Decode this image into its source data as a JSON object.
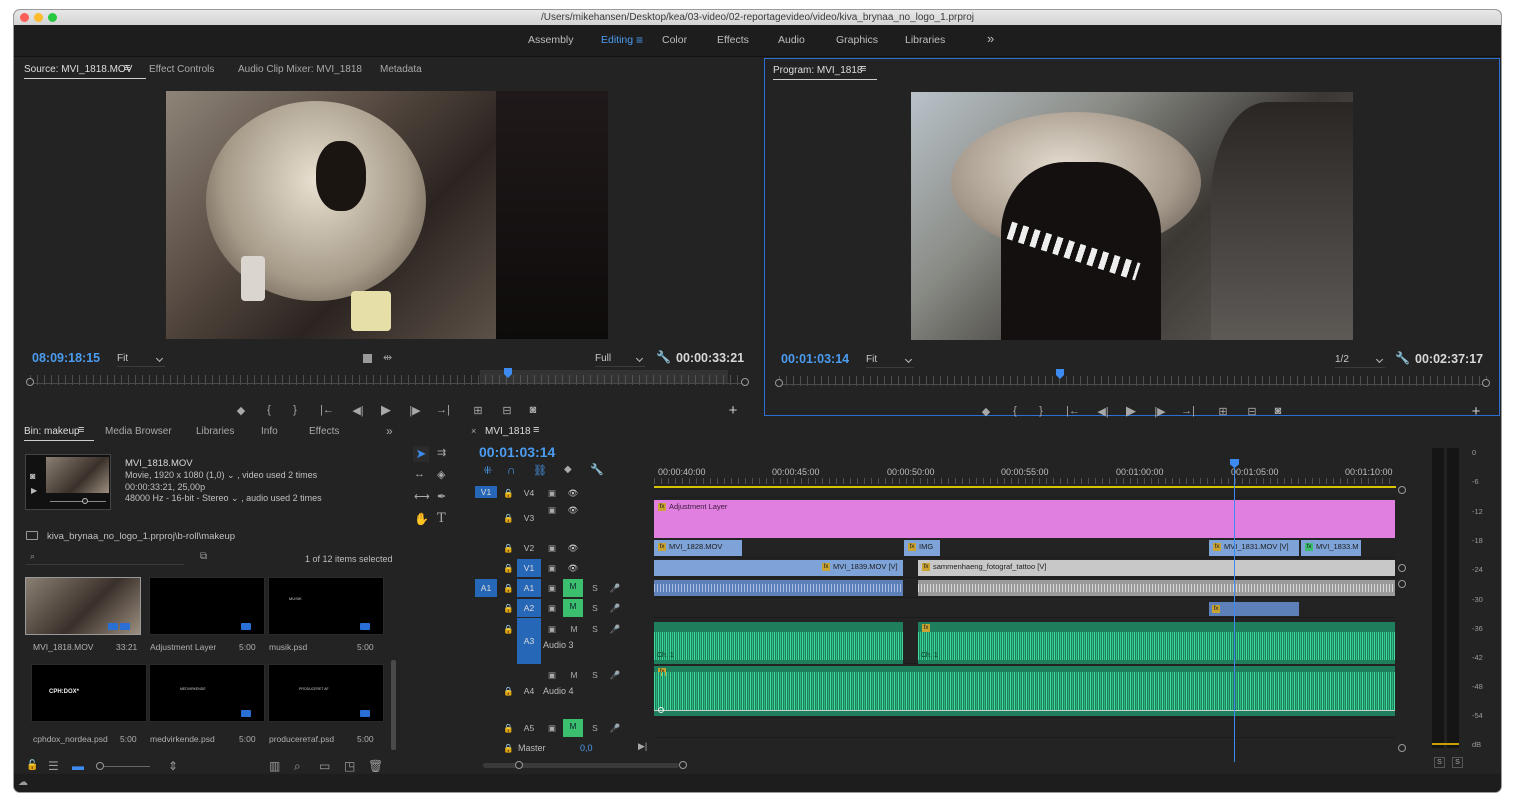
{
  "window": {
    "title": "/Users/mikehansen/Desktop/kea/03-video/02-reportagevideo/video/kiva_brynaa_no_logo_1.prproj"
  },
  "workspaces": {
    "items": [
      "Assembly",
      "Editing",
      "Color",
      "Effects",
      "Audio",
      "Graphics",
      "Libraries"
    ],
    "active": "Editing",
    "more": "»"
  },
  "source": {
    "tabs": [
      "Source: MVI_1818.MOV",
      "Effect Controls",
      "Audio Clip Mixer: MVI_1818",
      "Metadata"
    ],
    "timecode_in": "08:09:18:15",
    "fit": "Fit",
    "resolution": "Full",
    "duration": "00:00:33:21"
  },
  "program": {
    "tab": "Program: MVI_1818",
    "timecode": "00:01:03:14",
    "fit": "Fit",
    "resolution": "1/2",
    "duration": "00:02:37:17"
  },
  "colors": {
    "accent_blue": "#4b9cf0",
    "adjustment": "#e07fe0",
    "video_clip": "#7ea3d8",
    "audio_green": "#2bb783",
    "grey_clip": "#c8c8c8"
  },
  "project": {
    "tabs": [
      "Bin: makeup",
      "Media Browser",
      "Libraries",
      "Info",
      "Effects"
    ],
    "more": "»",
    "info": {
      "name": "MVI_1818.MOV",
      "line1": "Movie, 1920 x 1080 (1,0) ⌄ , video used 2 times",
      "line2": "00:00:33:21, 25,00p",
      "line3": "48000 Hz - 16-bit - Stereo ⌄ , audio used 2 times"
    },
    "path": "kiva_brynaa_no_logo_1.prproj\\b-roll\\makeup",
    "search_placeholder": "",
    "selected": "1 of 12 items selected",
    "items": [
      {
        "name": "MVI_1818.MOV",
        "duration": "33:21",
        "thumb_text": ""
      },
      {
        "name": "Adjustment Layer",
        "duration": "5:00",
        "thumb_text": ""
      },
      {
        "name": "musik.psd",
        "duration": "5:00",
        "thumb_text": "MUSIK"
      },
      {
        "name": "cphdox_nordea.psd",
        "duration": "5:00",
        "thumb_text": "CPH:DOX*"
      },
      {
        "name": "medvirkende.psd",
        "duration": "5:00",
        "thumb_text": "MEDVIRKENDE"
      },
      {
        "name": "producerетaf.psd",
        "duration": "5:00",
        "thumb_text": "PRODUCERET AF"
      }
    ]
  },
  "timeline": {
    "tab": "MVI_1818",
    "timecode": "00:01:03:14",
    "ruler": [
      "00:00:40:00",
      "00:00:45:00",
      "00:00:50:00",
      "00:00:55:00",
      "00:01:00:00",
      "00:01:05:00",
      "00:01:10:00"
    ],
    "tracks": [
      {
        "id": "V4",
        "label": ""
      },
      {
        "id": "V3",
        "label": ""
      },
      {
        "id": "V2",
        "label": ""
      },
      {
        "id": "V1",
        "label": ""
      },
      {
        "id": "A1",
        "label": ""
      },
      {
        "id": "A2",
        "label": ""
      },
      {
        "id": "A3",
        "label": "Audio 3"
      },
      {
        "id": "A4",
        "label": "Audio 4"
      },
      {
        "id": "A5",
        "label": ""
      }
    ],
    "source_patch": [
      "V1",
      "A1"
    ],
    "master": "Master",
    "master_value": "0,0",
    "clips": {
      "adjustment": "Adjustment Layer",
      "v2_a": "MVI_1828.MOV",
      "v2_b": "IMG",
      "v2_c": "MVI_1831.MOV [V]",
      "v2_d": "MVI_1833.M",
      "v1_a": "MVI_1839.MOV [V]",
      "v1_b": "sammenhaeng_fotograf_tattoo [V]",
      "ch1": "Ch. 1"
    },
    "btn": {
      "M": "M",
      "S": "S"
    }
  },
  "meter": {
    "labels": [
      "0",
      "-6",
      "-12",
      "-18",
      "-24",
      "-30",
      "-36",
      "-42",
      "-48",
      "-54",
      "dB"
    ],
    "solo": [
      "S",
      "S"
    ]
  }
}
